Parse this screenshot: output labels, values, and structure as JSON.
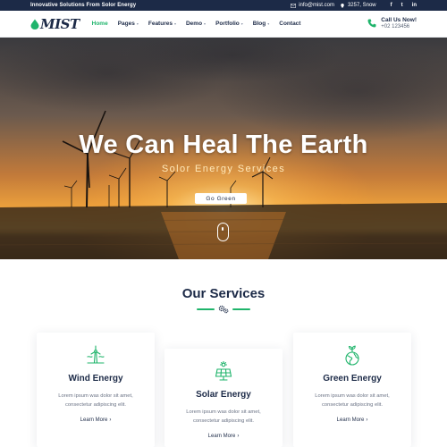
{
  "topbar": {
    "tagline": "Innovative Solutions From Solor Energy",
    "email": "info@mist.com",
    "address": "3257, Snow",
    "social": [
      "f",
      "t",
      "in"
    ]
  },
  "header": {
    "logo_text": "MIST",
    "nav": [
      {
        "label": "Home",
        "active": true,
        "has_caret": false
      },
      {
        "label": "Pages",
        "active": false,
        "has_caret": true
      },
      {
        "label": "Features",
        "active": false,
        "has_caret": true
      },
      {
        "label": "Demo",
        "active": false,
        "has_caret": true
      },
      {
        "label": "Portfolio",
        "active": false,
        "has_caret": true
      },
      {
        "label": "Blog",
        "active": false,
        "has_caret": true
      },
      {
        "label": "Contact",
        "active": false,
        "has_caret": false
      }
    ],
    "call_title": "Call Us Now!",
    "call_number": "+02 123456"
  },
  "hero": {
    "title": "We Can Heal The Earth",
    "subtitle": "Solor Energy Services",
    "button_label": "Go Green"
  },
  "services": {
    "title": "Our Services",
    "cards": [
      {
        "icon": "wind-turbine-icon",
        "title": "Wind Energy",
        "desc": "Lorem ipsum was dolor sit amet, consectetur adipiscing elit.",
        "more": "Learn More"
      },
      {
        "icon": "solar-panel-icon",
        "title": "Solar Energy",
        "desc": "Lorem ipsum was dolor sit amet, consectetur adipiscing elit.",
        "more": "Learn More"
      },
      {
        "icon": "green-globe-icon",
        "title": "Green Energy",
        "desc": "Lorem ipsum was dolor sit amet, consectetur adipiscing elit.",
        "more": "Learn More"
      }
    ]
  },
  "colors": {
    "navy": "#1c2a47",
    "accent_green": "#1fb46b",
    "white": "#ffffff"
  }
}
